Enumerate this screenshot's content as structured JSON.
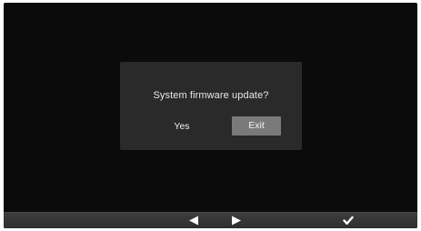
{
  "dialog": {
    "message": "System firmware update?",
    "yes_label": "Yes",
    "exit_label": "Exit",
    "selected": "Exit"
  },
  "bottom_bar": {
    "buttons": [
      {
        "icon": "left-arrow-icon"
      },
      {
        "icon": "right-arrow-icon"
      },
      {
        "icon": "checkmark-icon"
      }
    ]
  },
  "colors": {
    "screen_background": "#0b0b0b",
    "dialog_background": "#2a2a2a",
    "selected_button": "#7a7a7a",
    "bottom_bar": "#363636",
    "text": "#e8e8e8"
  }
}
